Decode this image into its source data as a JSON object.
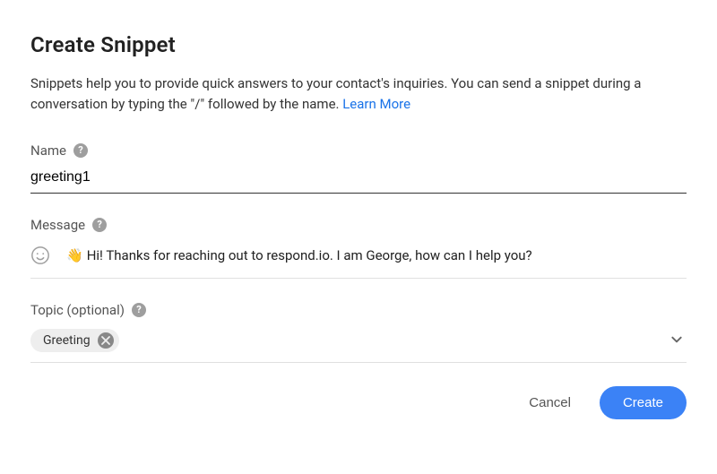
{
  "title": "Create Snippet",
  "description_part1": "Snippets help you to provide quick answers to your contact's inquiries. You can send a snippet during a conversation by typing the \"/\" followed by the name. ",
  "learn_more_label": "Learn More",
  "name_field": {
    "label": "Name",
    "value": "greeting1"
  },
  "message_field": {
    "label": "Message",
    "emoji_prefix": "👋",
    "text": "Hi! Thanks for reaching out to respond.io. I am George, how can I help you?"
  },
  "topic_field": {
    "label": "Topic (optional)",
    "chip_label": "Greeting"
  },
  "actions": {
    "cancel_label": "Cancel",
    "create_label": "Create"
  },
  "icons": {
    "help_glyph": "?"
  }
}
